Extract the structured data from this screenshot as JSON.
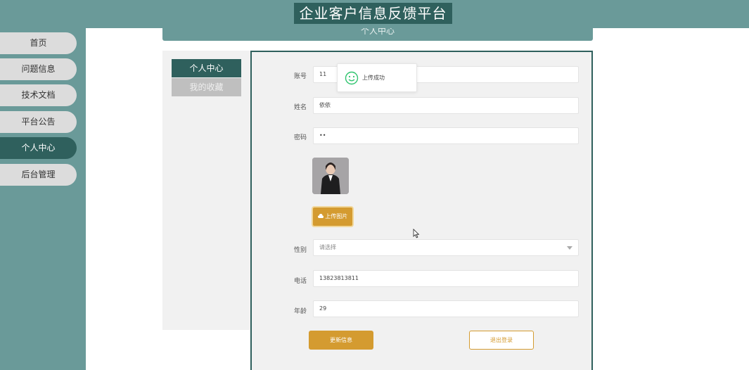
{
  "header": {
    "title": "企业客户信息反馈平台"
  },
  "sidebar": {
    "items": [
      {
        "label": "首页",
        "active": false
      },
      {
        "label": "问题信息",
        "active": false
      },
      {
        "label": "技术文档",
        "active": false
      },
      {
        "label": "平台公告",
        "active": false
      },
      {
        "label": "个人中心",
        "active": true
      },
      {
        "label": "后台管理",
        "active": false
      }
    ]
  },
  "banner": {
    "text": "个人中心"
  },
  "tabs": [
    {
      "label": "个人中心",
      "active": true
    },
    {
      "label": "我的收藏",
      "active": false
    }
  ],
  "form": {
    "account": {
      "label": "账号",
      "value": "11"
    },
    "name": {
      "label": "姓名",
      "value": "依依"
    },
    "password": {
      "label": "密码",
      "value": "••"
    },
    "upload_button": "上传图片",
    "gender": {
      "label": "性别",
      "placeholder": "请选择"
    },
    "phone": {
      "label": "电话",
      "value": "13823813811"
    },
    "age": {
      "label": "年龄",
      "value": "29"
    },
    "update_button": "更新信息",
    "logout_button": "退出登录"
  },
  "toast": {
    "text": "上传成功",
    "color": "#2fc46e"
  },
  "colors": {
    "primary": "#2f605d",
    "sidebar": "#6a9a99",
    "accent": "#d49b30"
  }
}
